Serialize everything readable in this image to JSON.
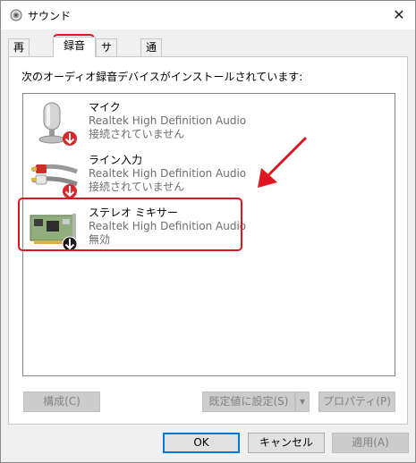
{
  "window": {
    "title": "サウンド",
    "close_glyph": "✕"
  },
  "tabs": [
    {
      "label": "再生"
    },
    {
      "label": "録音"
    },
    {
      "label": "サウンド"
    },
    {
      "label": "通信"
    }
  ],
  "description": "次のオーディオ録音デバイスがインストールされています:",
  "devices": [
    {
      "name": "マイク",
      "driver": "Realtek High Definition Audio",
      "status": "接続されていません",
      "icon": "microphone-icon",
      "badge": "disconnected-red-arrow"
    },
    {
      "name": "ライン入力",
      "driver": "Realtek High Definition Audio",
      "status": "接続されていません",
      "icon": "line-in-cable-icon",
      "badge": "disconnected-red-arrow"
    },
    {
      "name": "ステレオ ミキサー",
      "driver": "Realtek High Definition Audio",
      "status": "無効",
      "icon": "sound-card-icon",
      "badge": "disabled-black-arrow"
    }
  ],
  "panel_buttons": {
    "configure": "構成(C)",
    "set_default": "既定値に設定(S)",
    "properties": "プロパティ(P)"
  },
  "footer": {
    "ok": "OK",
    "cancel": "キャンセル",
    "apply": "適用(A)"
  },
  "colors": {
    "annotation": "#e0161e",
    "badge_red": "#d9262b",
    "focus": "#0078d7"
  }
}
